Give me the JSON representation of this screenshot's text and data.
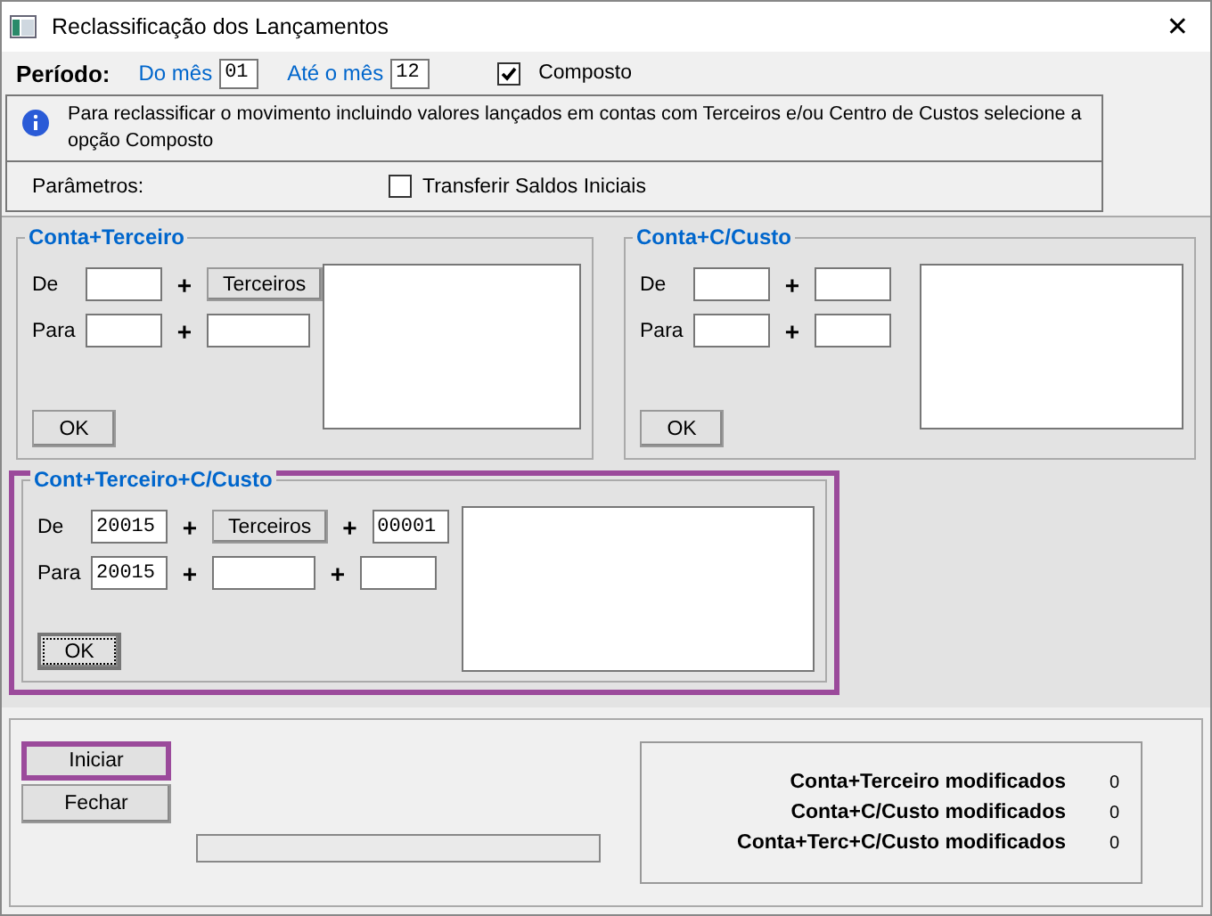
{
  "window": {
    "title": "Reclassificação dos Lançamentos",
    "close": "✕"
  },
  "period": {
    "label": "Período:",
    "from_label": "Do mês",
    "from_value": "01",
    "to_label": "Até o mês",
    "to_value": "12",
    "composto": {
      "label": "Composto",
      "checked": true
    }
  },
  "info": {
    "text": "Para reclassificar o movimento incluindo valores lançados em contas com Terceiros e/ou Centro de Custos selecione a opção Composto"
  },
  "parameters": {
    "label": "Parâmetros:",
    "transfer": {
      "label": "Transferir Saldos Iniciais",
      "checked": false
    }
  },
  "groups": [
    {
      "title": "Conta+Terceiro",
      "highlighted": false,
      "ok": "OK",
      "ok_focused": false,
      "rows": [
        {
          "label": "De",
          "items": [
            {
              "kind": "field",
              "value": ""
            },
            {
              "kind": "button",
              "label": "Terceiros"
            }
          ]
        },
        {
          "label": "Para",
          "items": [
            {
              "kind": "field",
              "value": ""
            },
            {
              "kind": "field",
              "value": ""
            }
          ]
        }
      ]
    },
    {
      "title": "Conta+C/Custo",
      "highlighted": false,
      "ok": "OK",
      "ok_focused": false,
      "rows": [
        {
          "label": "De",
          "items": [
            {
              "kind": "field",
              "value": ""
            },
            {
              "kind": "field",
              "value": ""
            }
          ]
        },
        {
          "label": "Para",
          "items": [
            {
              "kind": "field",
              "value": ""
            },
            {
              "kind": "field",
              "value": ""
            }
          ]
        }
      ]
    },
    {
      "title": "Cont+Terceiro+C/Custo",
      "highlighted": true,
      "ok": "OK",
      "ok_focused": true,
      "rows": [
        {
          "label": "De",
          "items": [
            {
              "kind": "field",
              "value": "20015"
            },
            {
              "kind": "button",
              "label": "Terceiros"
            },
            {
              "kind": "field",
              "value": "00001"
            }
          ]
        },
        {
          "label": "Para",
          "items": [
            {
              "kind": "field",
              "value": "20015"
            },
            {
              "kind": "field",
              "value": ""
            },
            {
              "kind": "field",
              "value": ""
            }
          ]
        }
      ]
    }
  ],
  "plus": "+",
  "buttons": [
    {
      "label": "Iniciar",
      "highlighted": true
    },
    {
      "label": "Fechar",
      "highlighted": false
    }
  ],
  "progress": {
    "level": 0
  },
  "stats": [
    {
      "label": "Conta+Terceiro modificados",
      "value": "0"
    },
    {
      "label": "Conta+C/Custo modificados",
      "value": "0"
    },
    {
      "label": "Conta+Terc+C/Custo modificados",
      "value": "0"
    }
  ]
}
